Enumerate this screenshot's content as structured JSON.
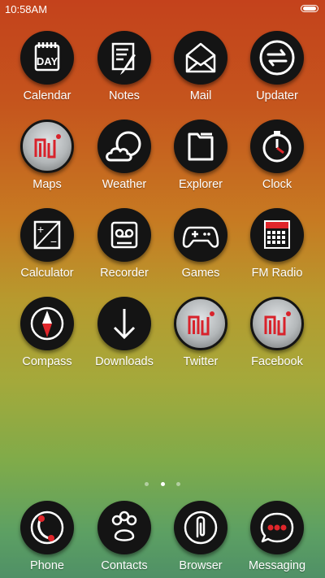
{
  "status_bar": {
    "time": "10:58AM"
  },
  "grid": [
    {
      "label": "Calendar",
      "icon": "calendar-icon",
      "icon_text": "DAY"
    },
    {
      "label": "Notes",
      "icon": "notes-icon"
    },
    {
      "label": "Mail",
      "icon": "mail-icon"
    },
    {
      "label": "Updater",
      "icon": "updater-icon"
    },
    {
      "label": "Maps",
      "icon": "mi-logo-icon"
    },
    {
      "label": "Weather",
      "icon": "weather-icon"
    },
    {
      "label": "Explorer",
      "icon": "folder-icon"
    },
    {
      "label": "Clock",
      "icon": "clock-icon"
    },
    {
      "label": "Calculator",
      "icon": "calculator-icon",
      "icon_plus": "+",
      "icon_minus": "−"
    },
    {
      "label": "Recorder",
      "icon": "recorder-icon"
    },
    {
      "label": "Games",
      "icon": "gamepad-icon"
    },
    {
      "label": "FM Radio",
      "icon": "fm-radio-icon"
    },
    {
      "label": "Compass",
      "icon": "compass-icon"
    },
    {
      "label": "Downloads",
      "icon": "download-arrow-icon"
    },
    {
      "label": "Twitter",
      "icon": "mi-logo-icon"
    },
    {
      "label": "Facebook",
      "icon": "mi-logo-icon"
    }
  ],
  "page_indicator": {
    "pages": 3,
    "current": 2
  },
  "dock": [
    {
      "label": "Phone",
      "icon": "phone-icon"
    },
    {
      "label": "Contacts",
      "icon": "paw-icon"
    },
    {
      "label": "Browser",
      "icon": "browser-icon"
    },
    {
      "label": "Messaging",
      "icon": "messaging-icon"
    }
  ],
  "colors": {
    "icon_bg": "#141414",
    "accent_red": "#e0262b",
    "text": "#ffffff"
  }
}
